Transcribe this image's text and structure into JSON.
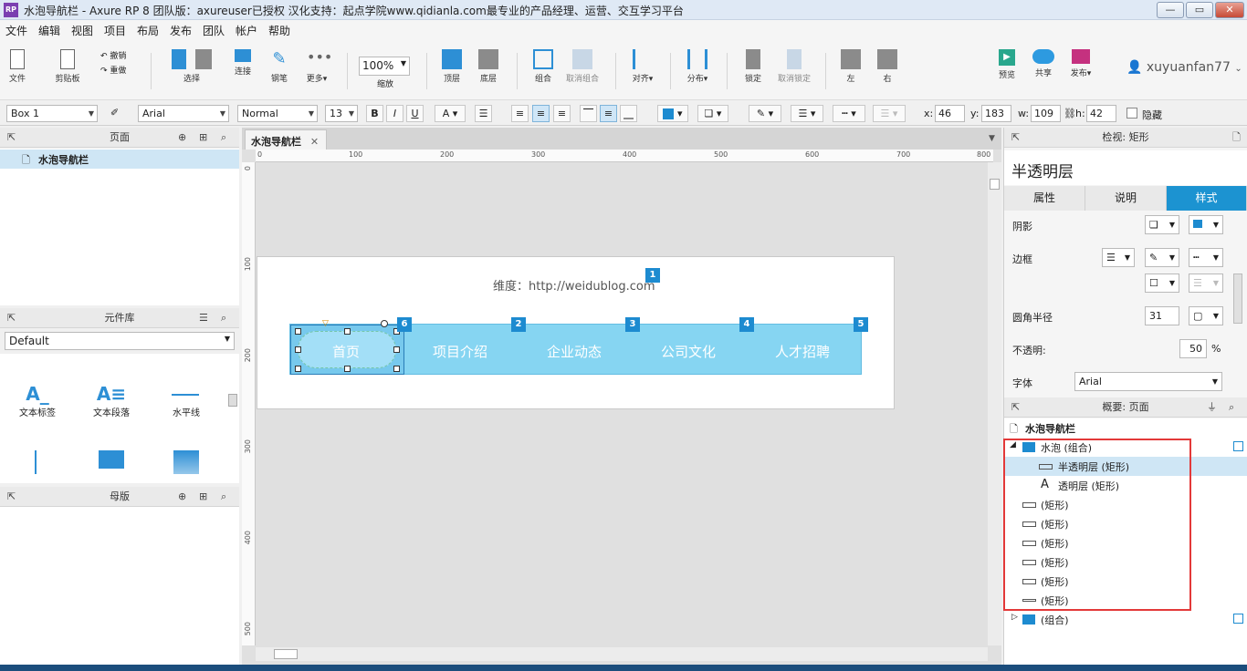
{
  "window": {
    "app_icon": "RP",
    "title": "水泡导航栏 - Axure RP 8 团队版：axureuser已授权 汉化支持：起点学院www.qidianla.com最专业的产品经理、运营、交互学习平台",
    "min": "—",
    "max": "▭",
    "close": "✕"
  },
  "menu": [
    "文件",
    "编辑",
    "视图",
    "项目",
    "布局",
    "发布",
    "团队",
    "帐户",
    "帮助"
  ],
  "toolbar": {
    "file": "文件",
    "clipboard": "剪贴板",
    "undo": "撤销",
    "redo": "重做",
    "select": "选择",
    "connect": "连接",
    "pen": "钢笔",
    "more": "更多▾",
    "zoom_value": "100%",
    "zoom": "缩放",
    "top": "顶层",
    "bottom": "底层",
    "group": "组合",
    "ungroup": "取消组合",
    "align": "对齐▾",
    "distribute": "分布▾",
    "lock": "锁定",
    "unlock": "取消锁定",
    "left": "左",
    "right": "右",
    "preview": "预览",
    "share": "共享",
    "publish": "发布▾",
    "user": "xuyuanfan77"
  },
  "format": {
    "widget_name": "Box 1",
    "font": "Arial",
    "style": "Normal",
    "size": "13",
    "bold": "B",
    "italic": "I",
    "underline": "U",
    "x_label": "x:",
    "x": "46",
    "y_label": "y:",
    "y": "183",
    "w_label": "w:",
    "w": "109",
    "h_label": "h:",
    "h": "42",
    "hidden": "隐藏"
  },
  "pages_panel": {
    "title": "页面",
    "page": "水泡导航栏"
  },
  "library_panel": {
    "title": "元件库",
    "library": "Default",
    "widgets": [
      "文本标签",
      "文本段落",
      "水平线"
    ]
  },
  "masters_panel": {
    "title": "母版"
  },
  "canvas": {
    "tab": "水泡导航栏",
    "tab_close": "✕",
    "ruler_h": [
      "0",
      "100",
      "200",
      "300",
      "400",
      "500",
      "600",
      "700",
      "800"
    ],
    "ruler_v": [
      "0",
      "100",
      "200",
      "300",
      "400",
      "500"
    ],
    "credit": "维度：http://weidublog.com",
    "nav_items": [
      "首页",
      "项目介绍",
      "企业动态",
      "公司文化",
      "人才招聘"
    ],
    "badges": [
      "1",
      "6",
      "2",
      "3",
      "4",
      "5"
    ]
  },
  "inspector": {
    "title": "检视: 矩形",
    "name": "半透明层",
    "tabs": [
      "属性",
      "说明",
      "样式"
    ],
    "shadow": "阴影",
    "border": "边框",
    "radius_label": "圆角半径",
    "radius": "31",
    "opacity_label": "不透明:",
    "opacity": "50",
    "opacity_unit": "%",
    "font_label": "字体",
    "font": "Arial"
  },
  "outline": {
    "title": "概要: 页面",
    "page": "水泡导航栏",
    "rows": [
      {
        "label": "水泡 (组合)"
      },
      {
        "label": "半透明层 (矩形)"
      },
      {
        "label": "透明层 (矩形)"
      },
      {
        "label": "(矩形)"
      },
      {
        "label": "(矩形)"
      },
      {
        "label": "(矩形)"
      },
      {
        "label": "(矩形)"
      },
      {
        "label": "(矩形)"
      },
      {
        "label": "(矩形)"
      },
      {
        "label": "(组合)"
      }
    ]
  }
}
